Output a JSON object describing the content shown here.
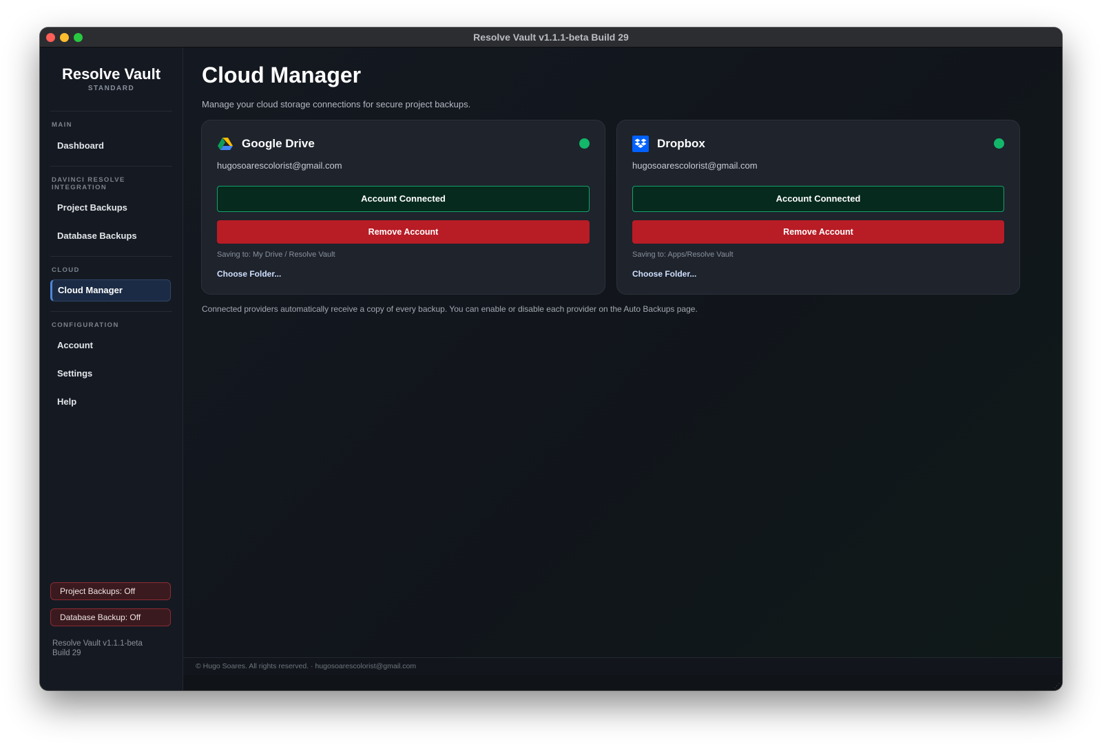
{
  "window": {
    "title": "Resolve Vault v1.1.1-beta Build 29"
  },
  "sidebar": {
    "brand": "Resolve Vault",
    "edition": "STANDARD",
    "sections": {
      "main": "MAIN",
      "integration": "DAVINCI RESOLVE INTEGRATION",
      "cloud": "CLOUD",
      "configuration": "CONFIGURATION"
    },
    "items": {
      "dashboard": "Dashboard",
      "project_backups": "Project Backups",
      "database_backups": "Database Backups",
      "cloud_manager": "Cloud Manager",
      "account": "Account",
      "settings": "Settings",
      "help": "Help"
    },
    "active_item": "Cloud Manager",
    "status": {
      "project_backups": "Project Backups: Off",
      "database_backup": "Database Backup: Off"
    },
    "version": "Resolve Vault v1.1.1-beta Build 29"
  },
  "main": {
    "title": "Cloud Manager",
    "subtitle": "Manage your cloud storage connections for secure project backups.",
    "providers": [
      {
        "name": "Google Drive",
        "icon": "google-drive-icon",
        "status": "connected",
        "email": "hugosoarescolorist@gmail.com",
        "connected_label": "Account Connected",
        "remove_label": "Remove Account",
        "saving_to": "Saving to: My Drive / Resolve Vault",
        "choose_folder": "Choose Folder..."
      },
      {
        "name": "Dropbox",
        "icon": "dropbox-icon",
        "status": "connected",
        "email": "hugosoarescolorist@gmail.com",
        "connected_label": "Account Connected",
        "remove_label": "Remove Account",
        "saving_to": "Saving to: Apps/Resolve Vault",
        "choose_folder": "Choose Folder..."
      }
    ],
    "footnote": "Connected providers automatically receive a copy of every backup. You can enable or disable each provider on the Auto Backups page."
  },
  "footer": {
    "text": "© Hugo Soares. All rights reserved.  ·  hugosoarescolorist@gmail.com"
  },
  "colors": {
    "accent_blue": "#4f86d8",
    "connected_green": "#12b76a",
    "danger_red": "#b81c25",
    "background": "#13161c"
  }
}
